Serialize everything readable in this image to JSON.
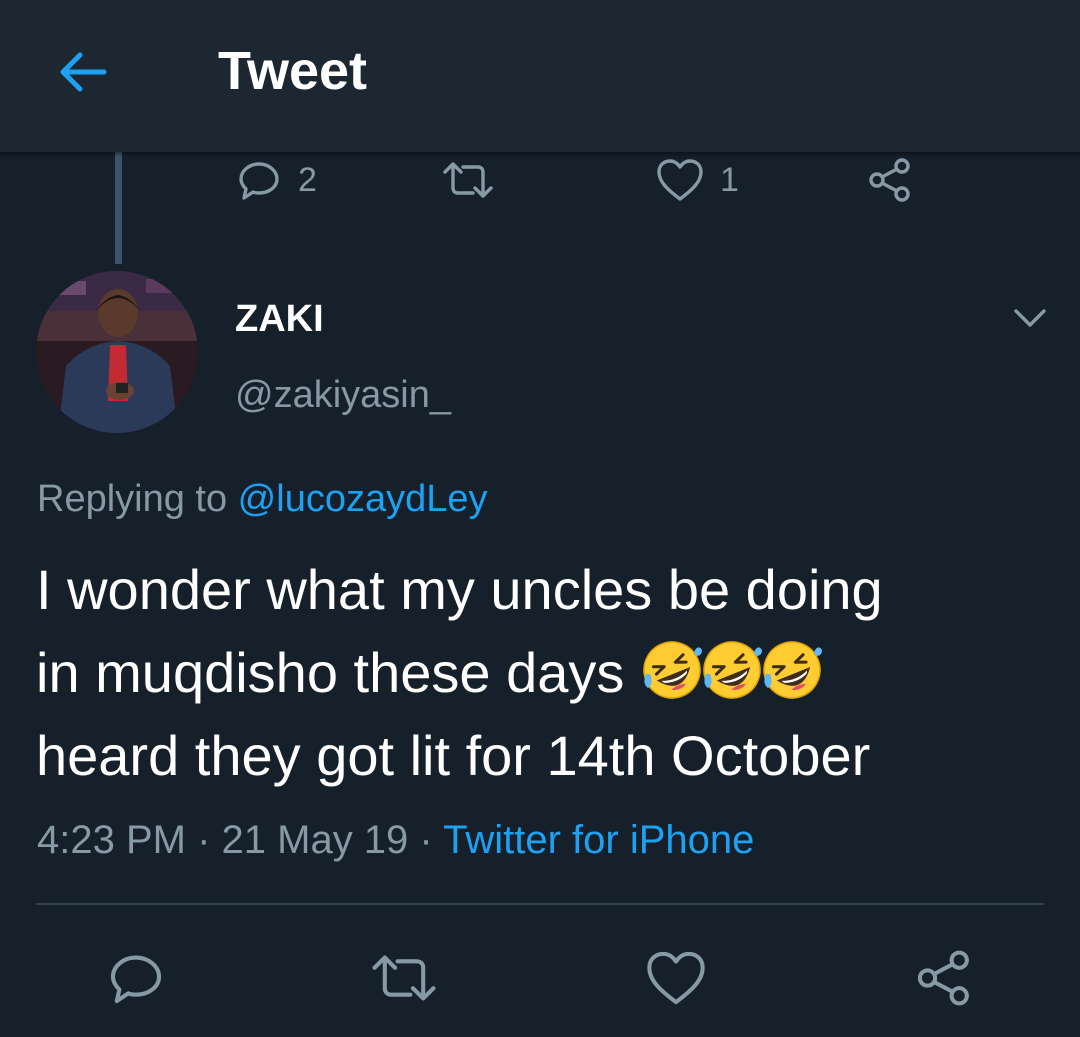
{
  "header": {
    "title": "Tweet",
    "back_icon": "arrow-left-icon"
  },
  "previous_tweet_actions": {
    "reply_count": "2",
    "retweet_count": "",
    "like_count": "1"
  },
  "tweet": {
    "author_name": "ZAKI",
    "author_handle": "@zakiyasin_",
    "replying_prefix": "Replying to ",
    "replying_to": "@lucozaydLey",
    "text_line1": "I wonder what my uncles be doing",
    "text_line2": "in muqdisho these days",
    "text_line3": "heard they got lit for 14th October",
    "emoji": [
      "rolling-on-floor-laughing",
      "rolling-on-floor-laughing",
      "rolling-on-floor-laughing"
    ],
    "time": "4:23 PM",
    "separator": " · ",
    "date": "21 May 19",
    "source": "Twitter for iPhone"
  },
  "colors": {
    "background": "#15202b",
    "header": "#1c2732",
    "accent": "#1da1f2",
    "secondary_text": "#8899a6",
    "icon": "#8899a6"
  }
}
